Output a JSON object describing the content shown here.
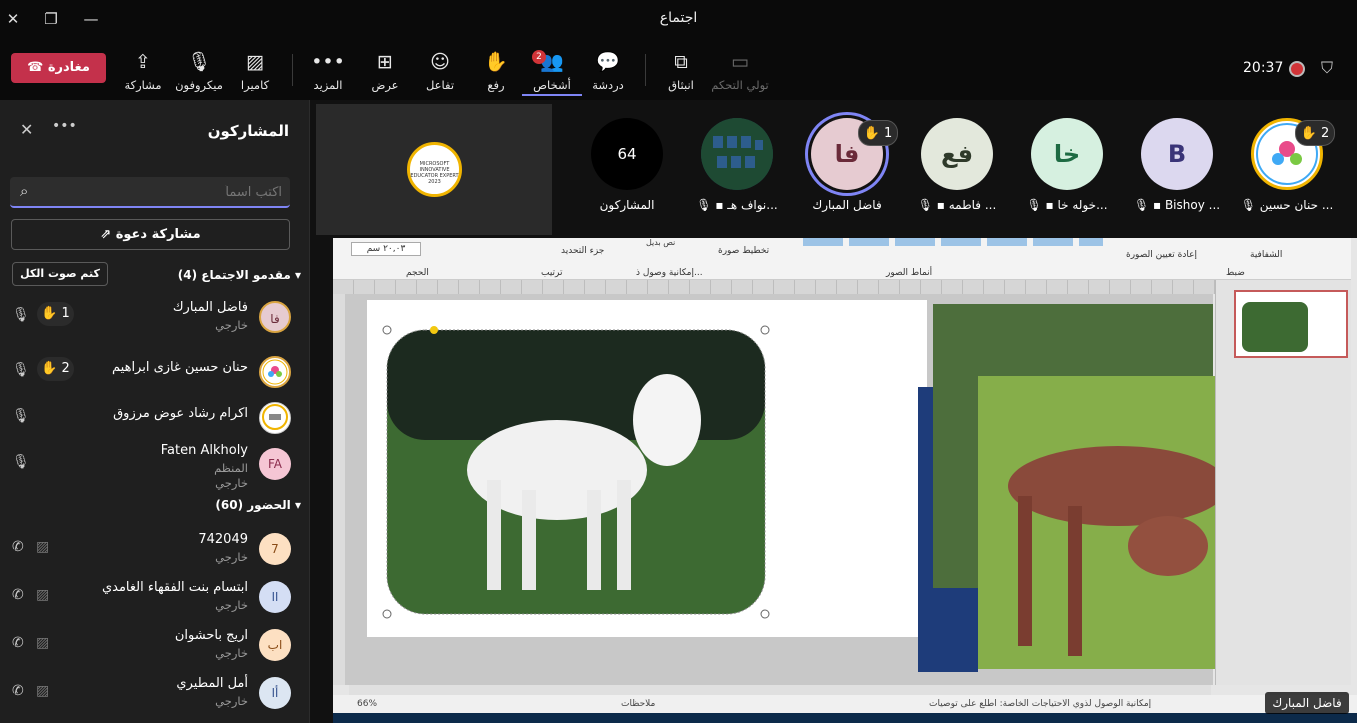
{
  "window": {
    "title": "اجتماع"
  },
  "toolbar": {
    "leave": "مغادرة",
    "share": "مشاركة",
    "mic": "ميكروفون",
    "camera": "كاميرا",
    "more": "المزيد",
    "view": "عرض",
    "react": "تفاعل",
    "raise": "رفع",
    "people": "أشخاص",
    "people_badge": "2",
    "chat": "دردشة",
    "popout": "انبثاق",
    "take_control": "تولي التحكم",
    "time": "20:37"
  },
  "pane": {
    "title": "المشاركون",
    "search_placeholder": "اكتب اسماً",
    "invite": "مشاركة دعوة",
    "mute_all": "كتم صوت الكل",
    "presenters_header": "مقدمو الاجتماع (4)",
    "attendees_header": "الحضور (60)",
    "presenters": [
      {
        "name": "فاضل المبارك",
        "role": "خارجي",
        "initials": "فا",
        "hand": "1"
      },
      {
        "name": "حنان حسين غازى ابراهيم",
        "role": "",
        "initials": "",
        "hand": "2"
      },
      {
        "name": "اكرام رشاد عوض مرزوق",
        "role": "",
        "initials": "",
        "hand": ""
      },
      {
        "name": "Faten Alkholy",
        "role": "المنظم",
        "role2": "خارجي",
        "initials": "FA",
        "hand": ""
      }
    ],
    "attendees": [
      {
        "name": "742049",
        "role": "خارجي",
        "initials": "7"
      },
      {
        "name": "ابتسام بنت الفقهاء الغامدي",
        "role": "خارجي",
        "initials": "اا"
      },
      {
        "name": "اريج باحشوان",
        "role": "خارجي",
        "initials": "اب"
      },
      {
        "name": "أمل المطيري",
        "role": "خارجي",
        "initials": "أا"
      }
    ]
  },
  "stage": {
    "participants_count": "64",
    "participants_label": "المشاركون",
    "tiles": [
      {
        "name": "نواف هـ...",
        "initials": ""
      },
      {
        "name": "فاضل المبارك",
        "initials": "فا",
        "hand": "1"
      },
      {
        "name": "فاطمه ...",
        "initials": "فع"
      },
      {
        "name": "خوله خا...",
        "initials": "خا"
      },
      {
        "name": "Bishoy ...",
        "initials": "B"
      },
      {
        "name": "حنان حسين ...",
        "initials": "",
        "hand": "2"
      }
    ],
    "presenter_tag": "فاضل المبارك",
    "logo_text": "MICROSOFT INNOVATIVE EDUCATOR EXPERT 2023"
  },
  "screen": {
    "ribbon_groups": [
      "ضبط",
      "أنماط الصور",
      "إمكانية وصول ذ...",
      "ترتيب",
      "الحجم"
    ],
    "ribbon_items": [
      "الشفافية",
      "إعادة تعيين الصورة",
      "تخطيط صورة",
      "جزء التحديد",
      "نص بديل",
      "٢٠,٠٣ سم"
    ],
    "zoom": "66%",
    "status_notes": "ملاحظات",
    "status_text": "إمكانية الوصول لذوي الاحتياجات الخاصة: اطلع على توصيات"
  },
  "colors": {
    "accent": "#7f85f5",
    "leave": "#c4314b",
    "recording": "#d13438"
  }
}
